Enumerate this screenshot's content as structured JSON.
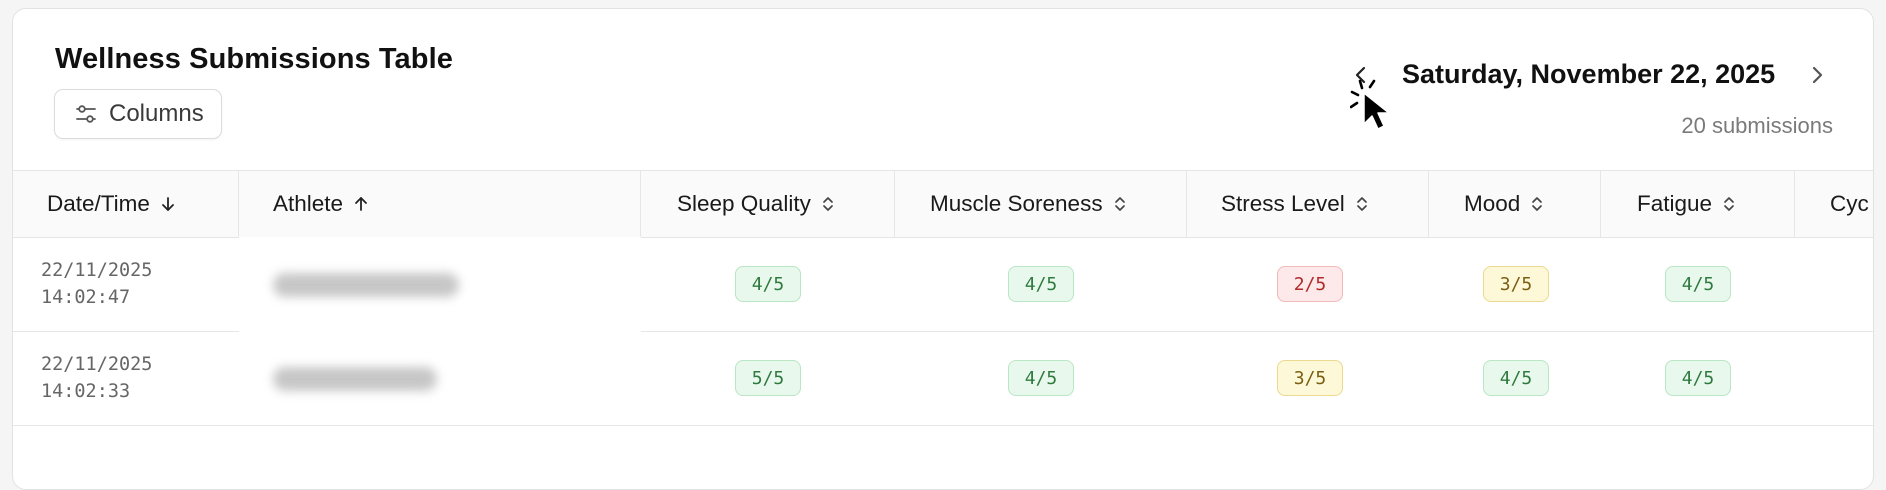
{
  "header": {
    "title": "Wellness Submissions Table",
    "columns_button": "Columns",
    "date": "Saturday, November 22, 2025",
    "submission_count": "20 submissions"
  },
  "table": {
    "columns": [
      {
        "label": "Date/Time",
        "sort": "desc",
        "icon": "arrow-down-icon"
      },
      {
        "label": "Athlete",
        "sort": "asc",
        "icon": "arrow-up-icon"
      },
      {
        "label": "Sleep Quality",
        "sort": "none",
        "icon": "sort-icon"
      },
      {
        "label": "Muscle Soreness",
        "sort": "none",
        "icon": "sort-icon"
      },
      {
        "label": "Stress Level",
        "sort": "none",
        "icon": "sort-icon"
      },
      {
        "label": "Mood",
        "sort": "none",
        "icon": "sort-icon"
      },
      {
        "label": "Fatigue",
        "sort": "none",
        "icon": "sort-icon"
      },
      {
        "label": "Cyc",
        "sort": "none",
        "icon": ""
      }
    ],
    "rows": [
      {
        "date": "22/11/2025",
        "time": "14:02:47",
        "athlete": "(blurred)",
        "sleep_quality": "4/5",
        "muscle_soreness": "4/5",
        "stress_level": "2/5",
        "mood": "3/5",
        "fatigue": "4/5"
      },
      {
        "date": "22/11/2025",
        "time": "14:02:33",
        "athlete": "(blurred)",
        "sleep_quality": "5/5",
        "muscle_soreness": "4/5",
        "stress_level": "3/5",
        "mood": "4/5",
        "fatigue": "4/5"
      }
    ]
  },
  "colors": {
    "good": "#2f7a3f",
    "bad": "#b02a2a",
    "medium": "#7a5f12"
  }
}
